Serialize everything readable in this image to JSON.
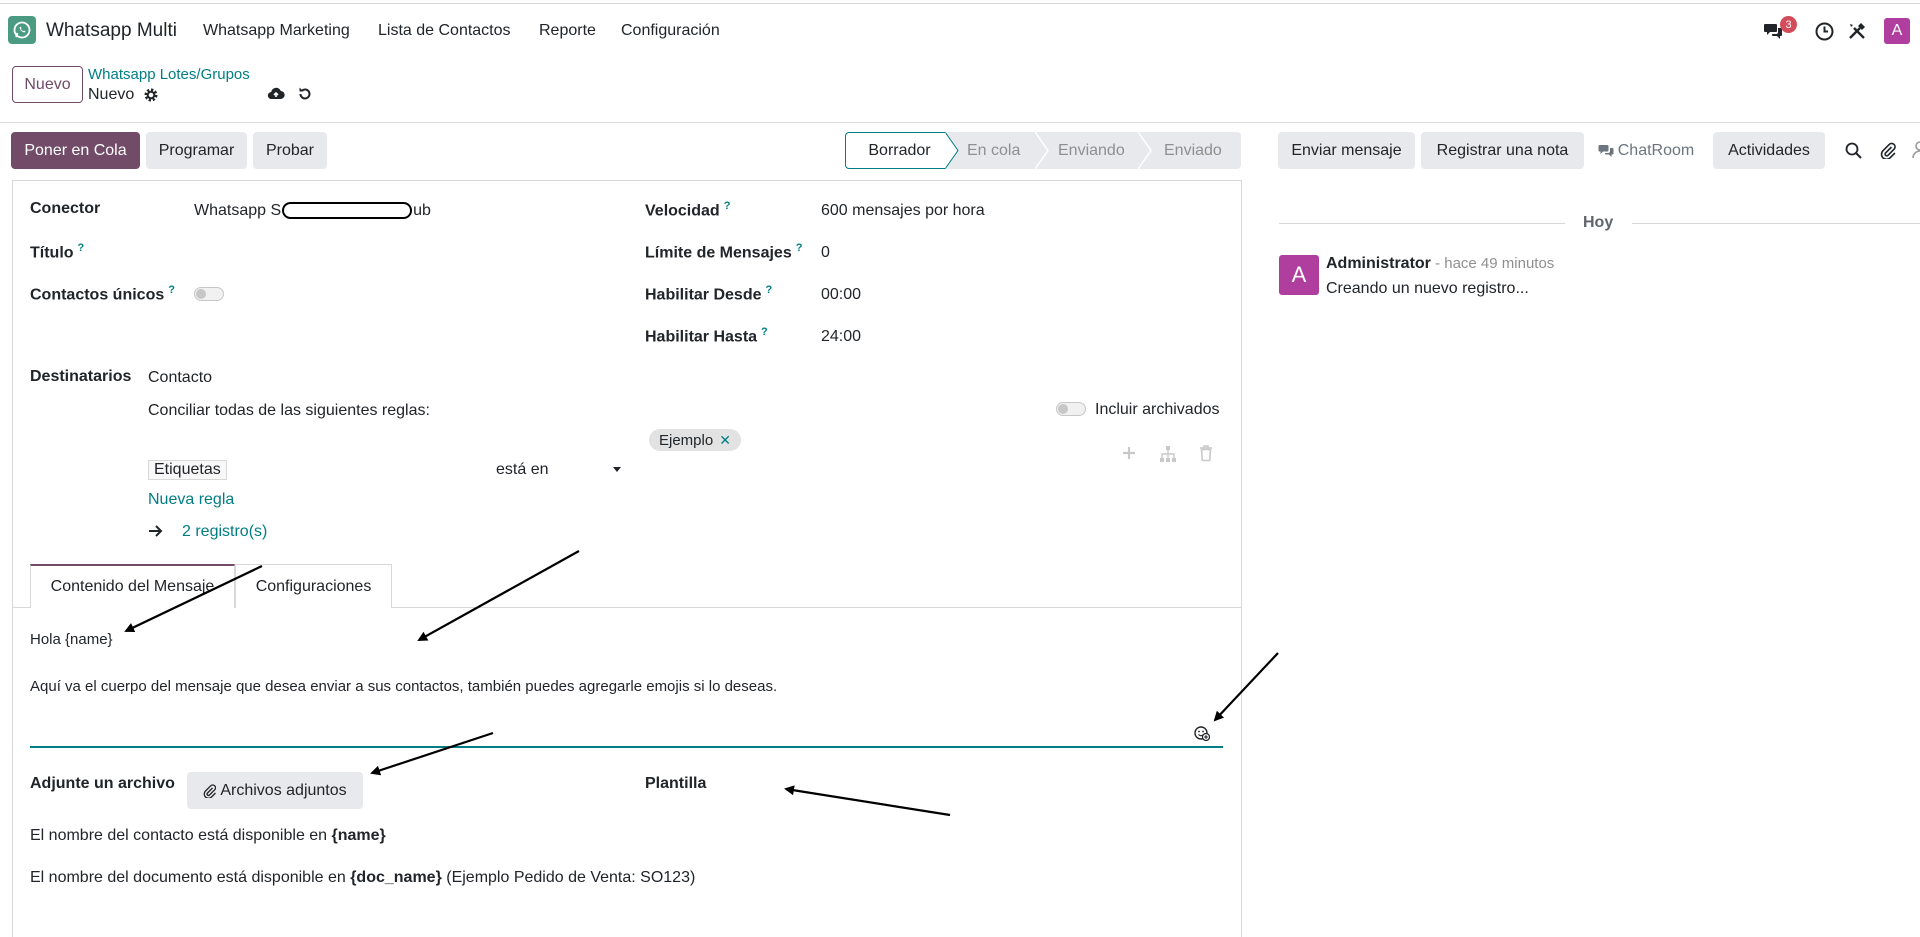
{
  "navbar": {
    "app_name": "Whatsapp Multi",
    "menu": [
      "Whatsapp Marketing",
      "Lista de Contactos",
      "Reporte",
      "Configuración"
    ],
    "message_count": "3",
    "user_initial": "A"
  },
  "control_panel": {
    "new_button": "Nuevo",
    "breadcrumb_parent": "Whatsapp Lotes/Grupos",
    "breadcrumb_current": "Nuevo"
  },
  "actions": {
    "queue": "Poner en Cola",
    "schedule": "Programar",
    "test": "Probar"
  },
  "status": {
    "steps": [
      "Borrador",
      "En cola",
      "Enviando",
      "Enviado"
    ],
    "active": "Borrador"
  },
  "form": {
    "connector_label": "Conector",
    "connector_value_start": "Whatsapp S",
    "connector_value_end": "ub",
    "title_label": "Título",
    "unique_label": "Contactos únicos",
    "speed_label": "Velocidad",
    "speed_value": "600 mensajes por hora",
    "limit_label": "Límite de Mensajes",
    "limit_value": "0",
    "from_label": "Habilitar Desde",
    "from_value": "00:00",
    "to_label": "Habilitar Hasta",
    "to_value": "24:00",
    "help_mark": "?",
    "recipients_label": "Destinatarios",
    "recipients_model": "Contacto",
    "rules_text": "Conciliar todas de las siguientes reglas:",
    "include_archived": "Incluir archivados",
    "rule_field": "Etiquetas",
    "rule_operator": "está en",
    "rule_tag": "Ejemplo",
    "new_rule": "Nueva regla",
    "records": "2 registro(s)"
  },
  "tabs": [
    "Contenido del Mensaje",
    "Configuraciones"
  ],
  "message": {
    "greeting": "Hola {name}",
    "body": "Aquí va el cuerpo del mensaje que desea enviar a sus contactos, también puedes agregarle emojis si lo deseas."
  },
  "attachments": {
    "label": "Adjunte un archivo",
    "button": "Archivos adjuntos",
    "template_label": "Plantilla"
  },
  "info": {
    "line1_prefix": "El nombre del contacto está disponible en ",
    "line1_var": "{name}",
    "line2_prefix": "El nombre del documento está disponible en ",
    "line2_var": "{doc_name}",
    "line2_suffix": " (Ejemplo Pedido de Venta: SO123)"
  },
  "chatter": {
    "send_message": "Enviar mensaje",
    "log_note": "Registrar una nota",
    "chatroom": "ChatRoom",
    "activities": "Actividades",
    "today": "Hoy",
    "author": "Administrator",
    "time": " - hace 49 minutos",
    "body": "Creando un nuevo registro...",
    "author_initial": "A"
  },
  "colors": {
    "primary": "#714b67",
    "teal": "#017e84",
    "avatar": "#b03e9e",
    "badge": "#d44c59"
  }
}
